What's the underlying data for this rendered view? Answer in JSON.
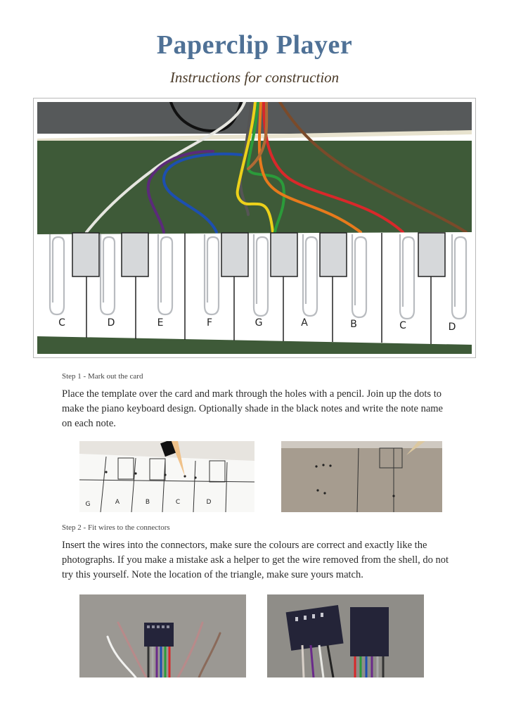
{
  "document": {
    "title": "Paperclip Player",
    "subtitle": "Instructions for construction"
  },
  "hero_photo": {
    "key_labels": [
      "C",
      "D",
      "E",
      "F",
      "G",
      "A",
      "B",
      "C",
      "D"
    ],
    "colors": {
      "table": "#3e5a38",
      "wall": "#56595a",
      "card": "#ffffff",
      "black_key": "#d6d8da"
    }
  },
  "steps": [
    {
      "heading": "Step 1 - Mark out the card",
      "body": "Place the template over the card and mark through the holes with a pencil. Join up the dots to make the piano keyboard design. Optionally shade in the black notes and write the note name on each note.",
      "photo_left_labels": [
        "G",
        "A",
        "B",
        "C",
        "D"
      ]
    },
    {
      "heading": "Step 2 - Fit wires to the connectors",
      "body": "Insert the wires into the connectors, make sure the colours are correct and exactly like the photographs. If you make a mistake ask a helper to get the wire removed from the shell, do not try this yourself. Note the location of the triangle, make sure yours match."
    }
  ],
  "accent_colors": {
    "title": "#4f7196",
    "subtitle": "#4a3a28"
  }
}
